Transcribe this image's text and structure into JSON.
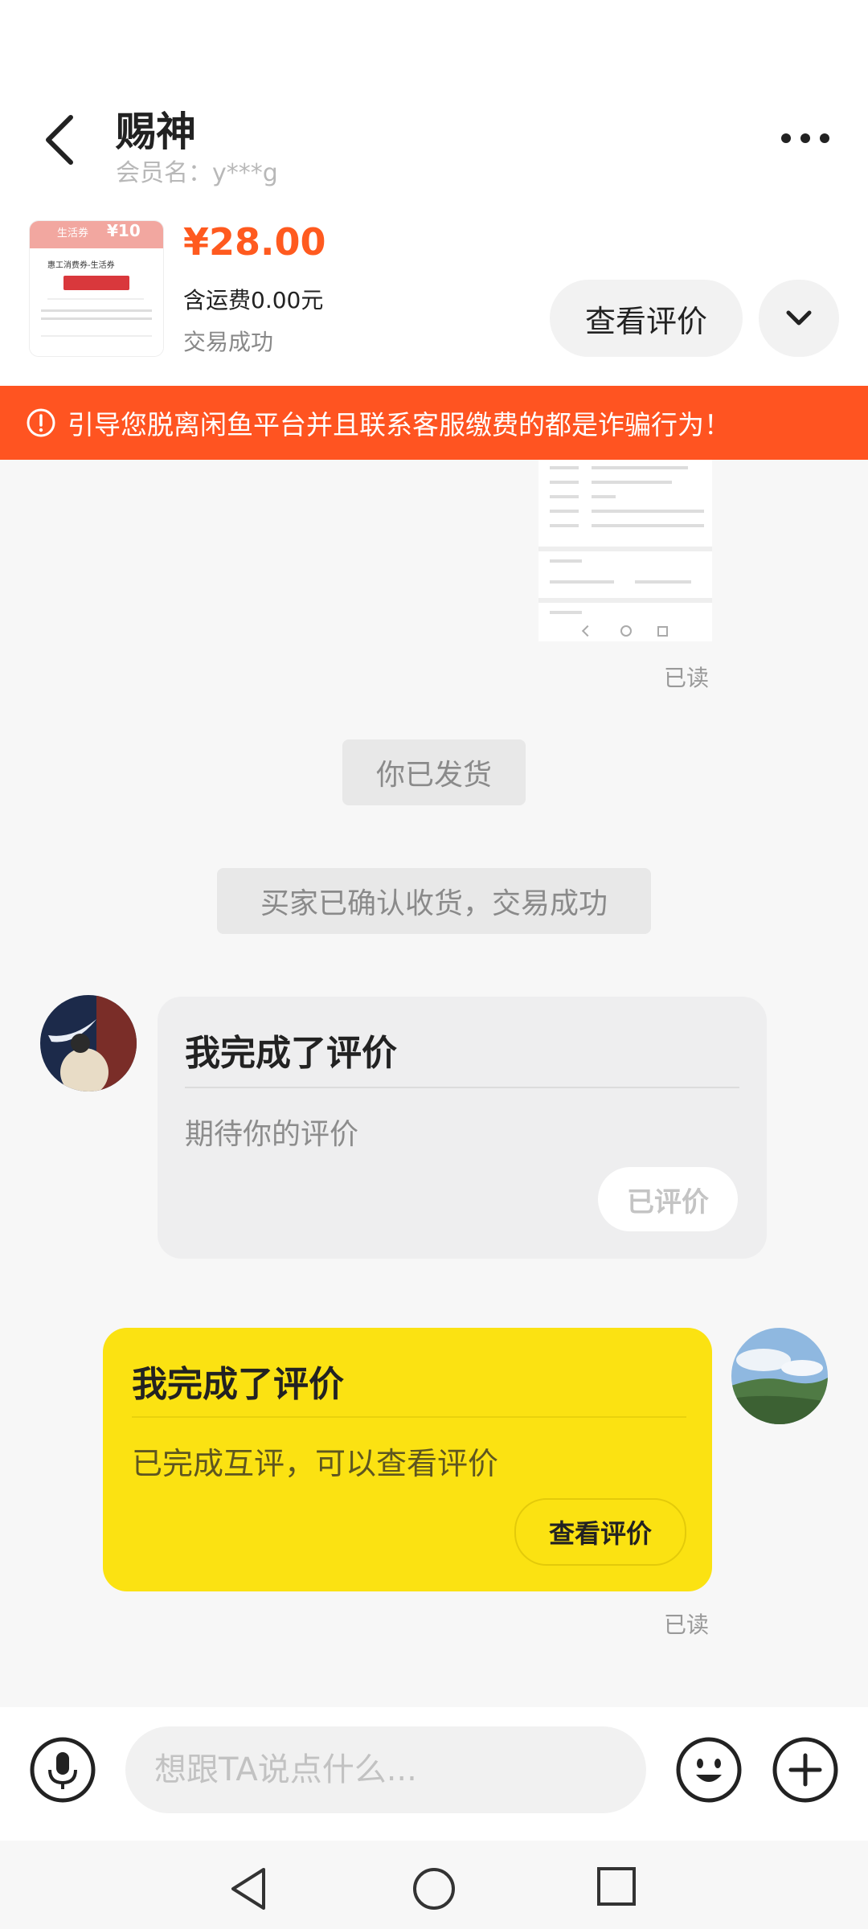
{
  "header": {
    "title": "赐神",
    "member_name": "会员名：y***g"
  },
  "product": {
    "thumbnail_tag": "生活券",
    "thumbnail_badge": "¥10",
    "thumbnail_caption": "惠工消费券-生活券",
    "price": "¥28.00",
    "shipping": "含运费0.00元",
    "status": "交易成功",
    "view_review_label": "查看评价"
  },
  "warning": {
    "text": "引导您脱离闲鱼平台并且联系客服缴费的都是诈骗行为！",
    "color": "#ff5421"
  },
  "chat": {
    "read_label_1": "已读",
    "system_shipped": "你已发货",
    "system_confirmed": "买家已确认收货，交易成功",
    "msg1": {
      "title": "我完成了评价",
      "subtitle": "期待你的评价",
      "button": "已评价"
    },
    "msg2": {
      "title": "我完成了评价",
      "subtitle": "已完成互评，可以查看评价",
      "button": "查看评价"
    },
    "read_label_2": "已读"
  },
  "input": {
    "placeholder": "想跟TA说点什么..."
  },
  "colors": {
    "accent": "#ff5a1f",
    "bubble_self": "#fbe212"
  }
}
